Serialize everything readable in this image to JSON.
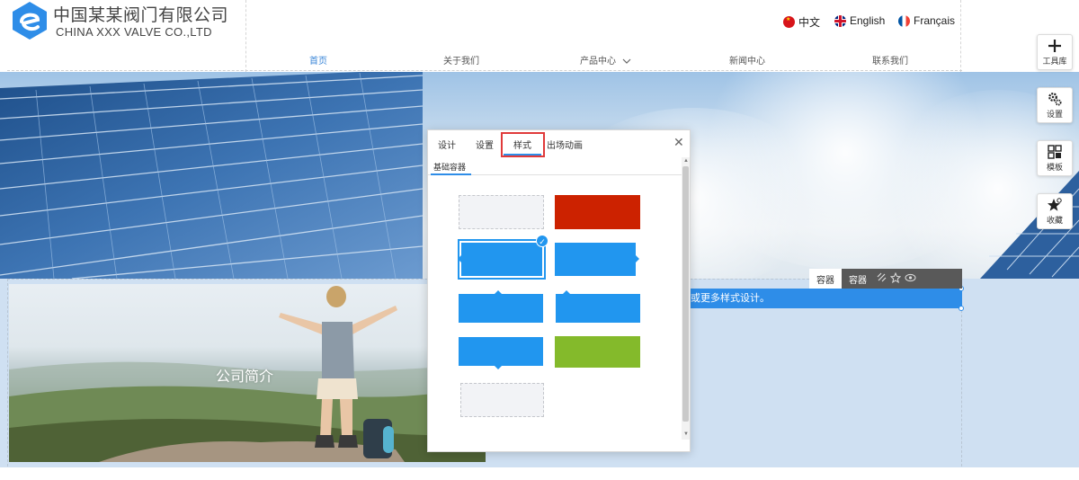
{
  "brand": {
    "name_cn": "中国某某阀门有限公司",
    "name_en": "CHINA XXX VALVE CO.,LTD",
    "logo_color": "#2e8de8"
  },
  "languages": [
    {
      "label": "中文",
      "flag": "china-flag-icon"
    },
    {
      "label": "English",
      "flag": "uk-flag-icon"
    },
    {
      "label": "Français",
      "flag": "france-flag-icon"
    }
  ],
  "nav": {
    "items": [
      {
        "label": "首页",
        "active": true
      },
      {
        "label": "关于我们",
        "active": false
      },
      {
        "label": "产品中心",
        "active": false,
        "dropdown_icon": "chevron-down-icon"
      },
      {
        "label": "新闻中心",
        "active": false
      },
      {
        "label": "联系我们",
        "active": false
      }
    ],
    "active_color": "#3a86d8"
  },
  "section": {
    "photo_title": "公司简介",
    "selected_text": "或更多样式设计。"
  },
  "selection_bar": {
    "chips": [
      "容器",
      "容器"
    ],
    "icons": [
      "unlink-icon",
      "star-icon",
      "eye-icon"
    ]
  },
  "toolbar": {
    "items": [
      {
        "label": "工具库",
        "icon": "plus-icon"
      },
      {
        "label": "设置",
        "icon": "gears-icon"
      },
      {
        "label": "模板",
        "icon": "grid-icon"
      },
      {
        "label": "收藏",
        "icon": "star-icon"
      }
    ]
  },
  "panel": {
    "tabs": [
      "设计",
      "设置",
      "样式",
      "出场动画"
    ],
    "active_tab": "样式",
    "sub_tab": "基础容器",
    "close_icon": "close-icon",
    "swatches": [
      {
        "style": "gray",
        "color": "#f2f3f6"
      },
      {
        "style": "red",
        "color": "#cc2200"
      },
      {
        "style": "blue-arrow-left",
        "color": "#2196ef",
        "selected": true
      },
      {
        "style": "blue-arrow-right",
        "color": "#2196ef"
      },
      {
        "style": "blue-arrow-top",
        "color": "#2196ef"
      },
      {
        "style": "blue-arrow-top",
        "color": "#2196ef"
      },
      {
        "style": "blue-arrow-bottom",
        "color": "#2196ef"
      },
      {
        "style": "green",
        "color": "#84ba2b"
      },
      {
        "style": "gray",
        "color": "#f2f3f6"
      }
    ],
    "highlight_color": "#e03a3a"
  }
}
